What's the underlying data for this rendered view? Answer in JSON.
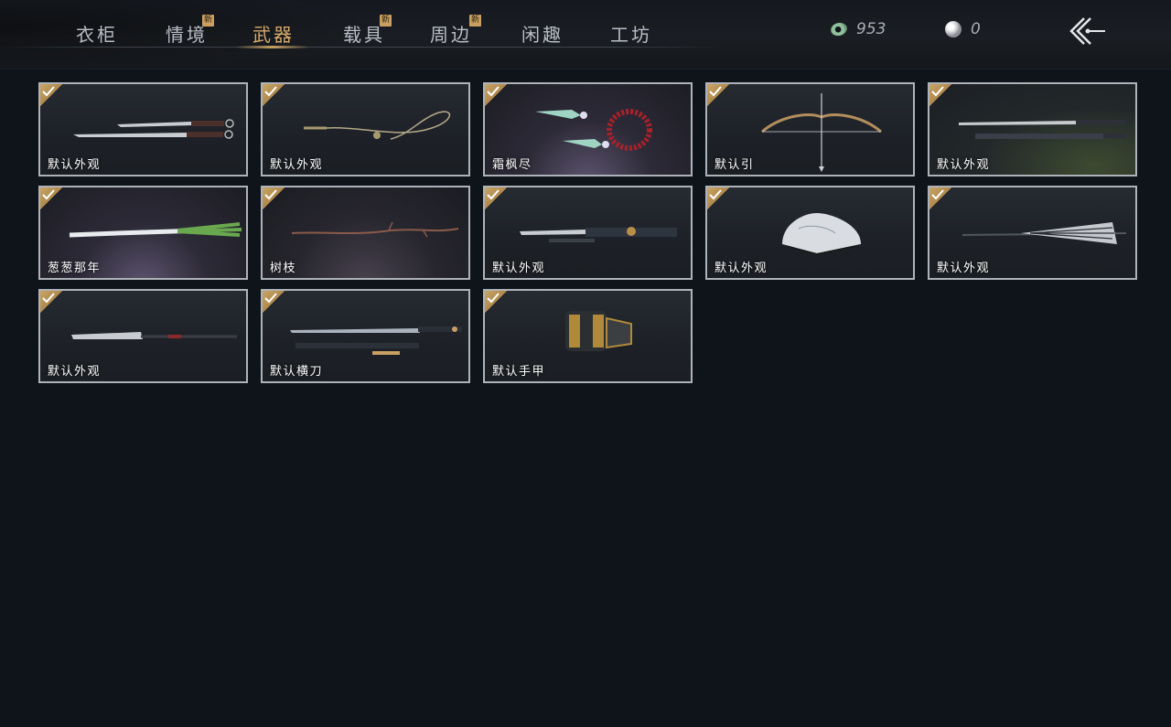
{
  "tabs": [
    {
      "label": "衣柜",
      "new": false,
      "active": false
    },
    {
      "label": "情境",
      "new": true,
      "active": false
    },
    {
      "label": "武器",
      "new": false,
      "active": true
    },
    {
      "label": "载具",
      "new": true,
      "active": false
    },
    {
      "label": "周边",
      "new": true,
      "active": false
    },
    {
      "label": "闲趣",
      "new": false,
      "active": false
    },
    {
      "label": "工坊",
      "new": false,
      "active": false
    }
  ],
  "new_badge": "新",
  "currency": {
    "jade": {
      "icon": "jade-coin-icon",
      "amount": "953"
    },
    "pearl": {
      "icon": "pearl-icon",
      "amount": "0"
    }
  },
  "back_button": {
    "icon": "back-arrow-icon"
  },
  "items": [
    {
      "label": "默认外观",
      "art": "twin-swords",
      "equipped": true
    },
    {
      "label": "默认外观",
      "art": "rope-dart",
      "equipped": true
    },
    {
      "label": "霜枫尽",
      "art": "jade-darts-beads",
      "equipped": true
    },
    {
      "label": "默认引",
      "art": "bow",
      "equipped": true
    },
    {
      "label": "默认外观",
      "art": "long-sword",
      "equipped": true
    },
    {
      "label": "葱葱那年",
      "art": "green-onion",
      "equipped": true
    },
    {
      "label": "树枝",
      "art": "branch",
      "equipped": true
    },
    {
      "label": "默认外观",
      "art": "ornate-sword",
      "equipped": true
    },
    {
      "label": "默认外观",
      "art": "folding-fan",
      "equipped": true
    },
    {
      "label": "默认外观",
      "art": "umbrella",
      "equipped": true
    },
    {
      "label": "默认外观",
      "art": "glaive",
      "equipped": true
    },
    {
      "label": "默认横刀",
      "art": "hengdao",
      "equipped": true
    },
    {
      "label": "默认手甲",
      "art": "gauntlet",
      "equipped": true
    }
  ],
  "colors": {
    "background": "#0f131a",
    "accent_gold": "#c9a062",
    "card_border": "#aeb3b9",
    "tab_text": "#b9bec6"
  }
}
